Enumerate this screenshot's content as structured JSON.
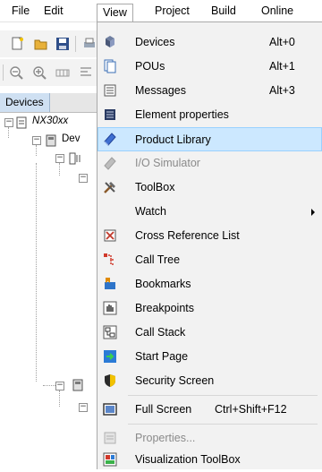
{
  "menubar": {
    "items": [
      {
        "label": "File"
      },
      {
        "label": "Edit"
      },
      {
        "label": "View"
      },
      {
        "label": "Project"
      },
      {
        "label": "Build"
      },
      {
        "label": "Online"
      }
    ]
  },
  "devices_panel": {
    "tab_label": "Devices",
    "tree": [
      {
        "label": "NX30xx"
      },
      {
        "label": "Dev"
      }
    ]
  },
  "view_menu": {
    "items": [
      {
        "label": "Devices",
        "shortcut": "Alt+0",
        "icon": "devices-icon"
      },
      {
        "label": "POUs",
        "shortcut": "Alt+1",
        "icon": "pous-icon"
      },
      {
        "label": "Messages",
        "shortcut": "Alt+3",
        "icon": "messages-icon"
      },
      {
        "label": "Element properties",
        "shortcut": "",
        "icon": "element-properties-icon"
      },
      {
        "label": "Product Library",
        "shortcut": "",
        "icon": "product-library-icon",
        "highlighted": true
      },
      {
        "label": "I/O Simulator",
        "shortcut": "",
        "icon": "io-simulator-icon",
        "disabled": true
      },
      {
        "label": "ToolBox",
        "shortcut": "",
        "icon": "toolbox-icon"
      },
      {
        "label": "Watch",
        "shortcut": "",
        "icon": "",
        "submenu": true
      },
      {
        "label": "Cross Reference List",
        "shortcut": "",
        "icon": "cross-reference-icon"
      },
      {
        "label": "Call Tree",
        "shortcut": "",
        "icon": "call-tree-icon"
      },
      {
        "label": "Bookmarks",
        "shortcut": "",
        "icon": "bookmarks-icon"
      },
      {
        "label": "Breakpoints",
        "shortcut": "",
        "icon": "breakpoints-icon"
      },
      {
        "label": "Call Stack",
        "shortcut": "",
        "icon": "call-stack-icon"
      },
      {
        "label": "Start Page",
        "shortcut": "",
        "icon": "start-page-icon"
      },
      {
        "label": "Security Screen",
        "shortcut": "",
        "icon": "security-screen-icon"
      },
      {
        "label": "Full Screen",
        "shortcut": "Ctrl+Shift+F12",
        "icon": "full-screen-icon"
      },
      {
        "label": "Properties...",
        "shortcut": "",
        "icon": "properties-icon",
        "disabled": true
      },
      {
        "label": "Visualization ToolBox",
        "shortcut": "",
        "icon": "visualization-toolbox-icon"
      }
    ]
  },
  "colors": {
    "highlight_bg": "#cce8ff",
    "highlight_border": "#99d1ff",
    "menu_bg": "#f2f2f2",
    "disabled_text": "#8a8a8a"
  }
}
